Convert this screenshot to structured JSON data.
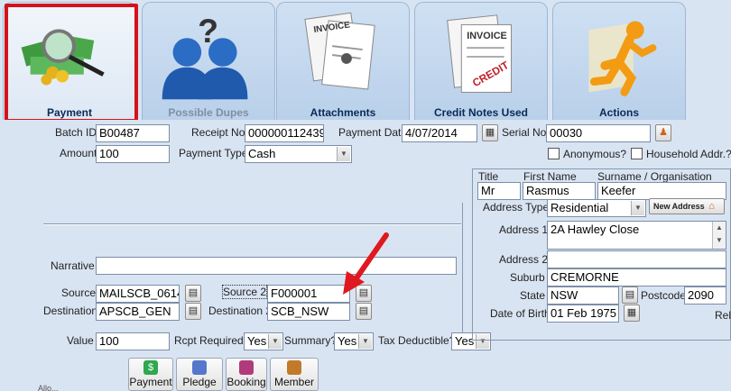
{
  "tabs": [
    {
      "label": "Payment"
    },
    {
      "label": "Possible Dupes"
    },
    {
      "label": "Attachments"
    },
    {
      "label": "Credit Notes Used"
    },
    {
      "label": "Actions"
    }
  ],
  "tab_art": {
    "invoice_text": "INVOICE",
    "credit_text": "CREDIT"
  },
  "form": {
    "batch_id_label": "Batch ID",
    "batch_id": "B00487",
    "receipt_no_label": "Receipt No.",
    "receipt_no": "000000112439",
    "payment_date_label": "Payment Date",
    "payment_date": "4/07/2014",
    "serial_no_label": "Serial No.",
    "serial_no": "00030",
    "amount_label": "Amount",
    "amount": "100",
    "payment_type_label": "Payment Type",
    "payment_type": "Cash",
    "anonymous_label": "Anonymous?",
    "household_label": "Household Addr.?",
    "narrative_label": "Narrative",
    "narrative": "",
    "source_label": "Source",
    "source": "MAILSCB_0614",
    "destination_label": "Destination",
    "destination": "APSCB_GEN",
    "source2_label": "Source 2",
    "source2": "F000001",
    "destination2_label": "Destination 2",
    "destination2": "SCB_NSW",
    "value_label": "Value",
    "value": "100",
    "rcpt_required_label": "Rcpt Required?",
    "rcpt_required": "Yes",
    "summary_label": "Summary?",
    "summary": "Yes",
    "tax_deductible_label": "Tax Deductible?",
    "tax_deductible": "Yes",
    "footer_fragment": "Allo..."
  },
  "address": {
    "title_header": "Title",
    "firstname_header": "First Name",
    "surname_header": "Surname / Organisation",
    "title": "Mr",
    "first_name": "Rasmus",
    "surname": "Keefer",
    "address_type_label": "Address Type",
    "address_type": "Residential",
    "new_address_label": "New Address",
    "address1_label": "Address 1",
    "address1": "2A Hawley Close",
    "address2_label": "Address 2",
    "address2": "",
    "suburb_label": "Suburb",
    "suburb": "CREMORNE",
    "state_label": "State",
    "state": "NSW",
    "postcode_label": "Postcode",
    "postcode": "2090",
    "dob_label": "Date of Birth",
    "dob": "01 Feb 1975",
    "rel_label": "Rel"
  },
  "buttons": [
    {
      "label": "Payment",
      "icon": "dollar-icon",
      "color": "#2fa84f"
    },
    {
      "label": "Pledge",
      "icon": "pledge-icon",
      "color": "#5577cc"
    },
    {
      "label": "Booking",
      "icon": "booking-icon",
      "color": "#b03a7a"
    },
    {
      "label": "Member",
      "icon": "member-icon",
      "color": "#c27a2a"
    }
  ],
  "colors": {
    "highlight": "#d4121a",
    "arrow": "#e0181f",
    "tab_text": "#0a2a57"
  }
}
